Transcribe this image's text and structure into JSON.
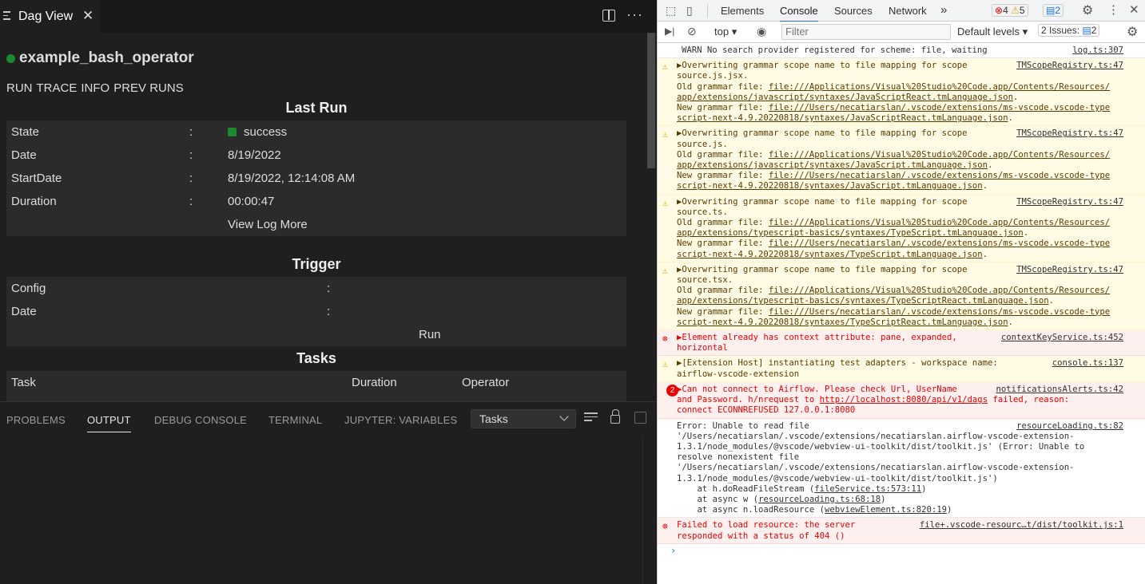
{
  "editor": {
    "tab_title": "Dag View",
    "dag_name": "example_bash_operator",
    "run_tabs": [
      "RUN",
      "TRACE",
      "INFO",
      "PREV RUNS"
    ],
    "last_run": {
      "heading": "Last Run",
      "rows": [
        {
          "label": "State",
          "sep": ":",
          "value": "success"
        },
        {
          "label": "Date",
          "sep": ":",
          "value": "8/19/2022"
        },
        {
          "label": "StartDate",
          "sep": ":",
          "value": "8/19/2022, 12:14:08 AM"
        },
        {
          "label": "Duration",
          "sep": ":",
          "value": "00:00:47"
        }
      ],
      "view_log": "View Log More"
    },
    "trigger": {
      "heading": "Trigger",
      "rows": [
        {
          "label": "Config",
          "sep": ":"
        },
        {
          "label": "Date",
          "sep": ":"
        }
      ],
      "run": "Run"
    },
    "tasks": {
      "heading": "Tasks",
      "columns": [
        "Task",
        "Duration",
        "Operator"
      ]
    }
  },
  "panel": {
    "tabs": [
      "PROBLEMS",
      "OUTPUT",
      "DEBUG CONSOLE",
      "TERMINAL",
      "JUPYTER: VARIABLES"
    ],
    "active": "OUTPUT",
    "select_value": "Tasks"
  },
  "devtools": {
    "tabs": [
      "Elements",
      "Console",
      "Sources",
      "Network"
    ],
    "active_tab": "Console",
    "more": "»",
    "badge_errors": "4",
    "badge_warnings": "5",
    "badge_info": "2",
    "context": "top",
    "filter_placeholder": "Filter",
    "levels": "Default levels",
    "issues_label": "2 Issues:",
    "issues_count": "2"
  },
  "console": [
    {
      "type": "plain",
      "lines": [
        "WARN No search provider registered for scheme: file, waiting"
      ],
      "src": "log.ts:307"
    },
    {
      "type": "warn",
      "lines": [
        "▶Overwriting grammar scope name to file mapping for scope",
        "source.js.jsx."
      ],
      "old_label": "Old grammar file: ",
      "old": [
        "file:///Applications/Visual%20Studio%20Code.app/Contents/Resources/",
        "app/extensions/javascript/syntaxes/JavaScriptReact.tmLanguage.json"
      ],
      "new_label": "New grammar file: ",
      "new": [
        "file:///Users/necatiarslan/.vscode/extensions/ms-vscode.vscode-type",
        "script-next-4.9.20220818/syntaxes/JavaScriptReact.tmLanguage.json"
      ],
      "src": "TMScopeRegistry.ts:47"
    },
    {
      "type": "warn",
      "lines": [
        "▶Overwriting grammar scope name to file mapping for scope",
        "source.js."
      ],
      "old_label": "Old grammar file: ",
      "old": [
        "file:///Applications/Visual%20Studio%20Code.app/Contents/Resources/",
        "app/extensions/javascript/syntaxes/JavaScript.tmLanguage.json"
      ],
      "new_label": "New grammar file: ",
      "new": [
        "file:///Users/necatiarslan/.vscode/extensions/ms-vscode.vscode-type",
        "script-next-4.9.20220818/syntaxes/JavaScript.tmLanguage.json"
      ],
      "src": "TMScopeRegistry.ts:47"
    },
    {
      "type": "warn",
      "lines": [
        "▶Overwriting grammar scope name to file mapping for scope",
        "source.ts."
      ],
      "old_label": "Old grammar file: ",
      "old": [
        "file:///Applications/Visual%20Studio%20Code.app/Contents/Resources/",
        "app/extensions/typescript-basics/syntaxes/TypeScript.tmLanguage.json"
      ],
      "new_label": "New grammar file: ",
      "new": [
        "file:///Users/necatiarslan/.vscode/extensions/ms-vscode.vscode-type",
        "script-next-4.9.20220818/syntaxes/TypeScript.tmLanguage.json"
      ],
      "src": "TMScopeRegistry.ts:47"
    },
    {
      "type": "warn",
      "lines": [
        "▶Overwriting grammar scope name to file mapping for scope",
        "source.tsx."
      ],
      "old_label": "Old grammar file: ",
      "old": [
        "file:///Applications/Visual%20Studio%20Code.app/Contents/Resources/",
        "app/extensions/typescript-basics/syntaxes/TypeScriptReact.tmLanguage.json"
      ],
      "new_label": "New grammar file: ",
      "new": [
        "file:///Users/necatiarslan/.vscode/extensions/ms-vscode.vscode-type",
        "script-next-4.9.20220818/syntaxes/TypeScriptReact.tmLanguage.json"
      ],
      "src": "TMScopeRegistry.ts:47"
    },
    {
      "type": "error",
      "lines": [
        "▶Element already has context attribute: pane, expanded,",
        "horizontal"
      ],
      "src": "contextKeyService.ts:452"
    },
    {
      "type": "warn",
      "lines": [
        "▶[Extension Host] instantiating test adapters - workspace name:",
        "airflow-vscode-extension"
      ],
      "src": "console.ts:137"
    },
    {
      "type": "error",
      "count": "2",
      "lines": [
        "▶Can not connect to Airflow. Please check Url, UserName",
        "and Password.  h/nrequest to "
      ],
      "link": "http://localhost:8080/api/v1/dags",
      "after": " failed, reason:",
      "last": "connect ECONNREFUSED 127.0.0.1:8080",
      "src": "notificationsAlerts.ts:42"
    },
    {
      "type": "plain",
      "lines": [
        "Error: Unable to read file",
        "'/Users/necatiarslan/.vscode/extensions/necatiarslan.airflow-vscode-extension-",
        "1.3.1/node_modules/@vscode/webview-ui-toolkit/dist/toolkit.js' (Error: Unable to",
        "resolve nonexistent file",
        "'/Users/necatiarslan/.vscode/extensions/necatiarslan.airflow-vscode-extension-",
        "1.3.1/node_modules/@vscode/webview-ui-toolkit/dist/toolkit.js')"
      ],
      "stack": [
        {
          "pre": "    at h.doReadFileStream (",
          "link": "fileService.ts:573:11",
          "post": ")"
        },
        {
          "pre": "    at async w (",
          "link": "resourceLoading.ts:68:18",
          "post": ")"
        },
        {
          "pre": "    at async n.loadResource (",
          "link": "webviewElement.ts:820:19",
          "post": ")"
        }
      ],
      "src": "resourceLoading.ts:82"
    },
    {
      "type": "error",
      "lines": [
        "Failed to load resource: the server",
        "responded with a status of 404 ()"
      ],
      "src": "file+.vscode-resourc…t/dist/toolkit.js:1"
    }
  ]
}
